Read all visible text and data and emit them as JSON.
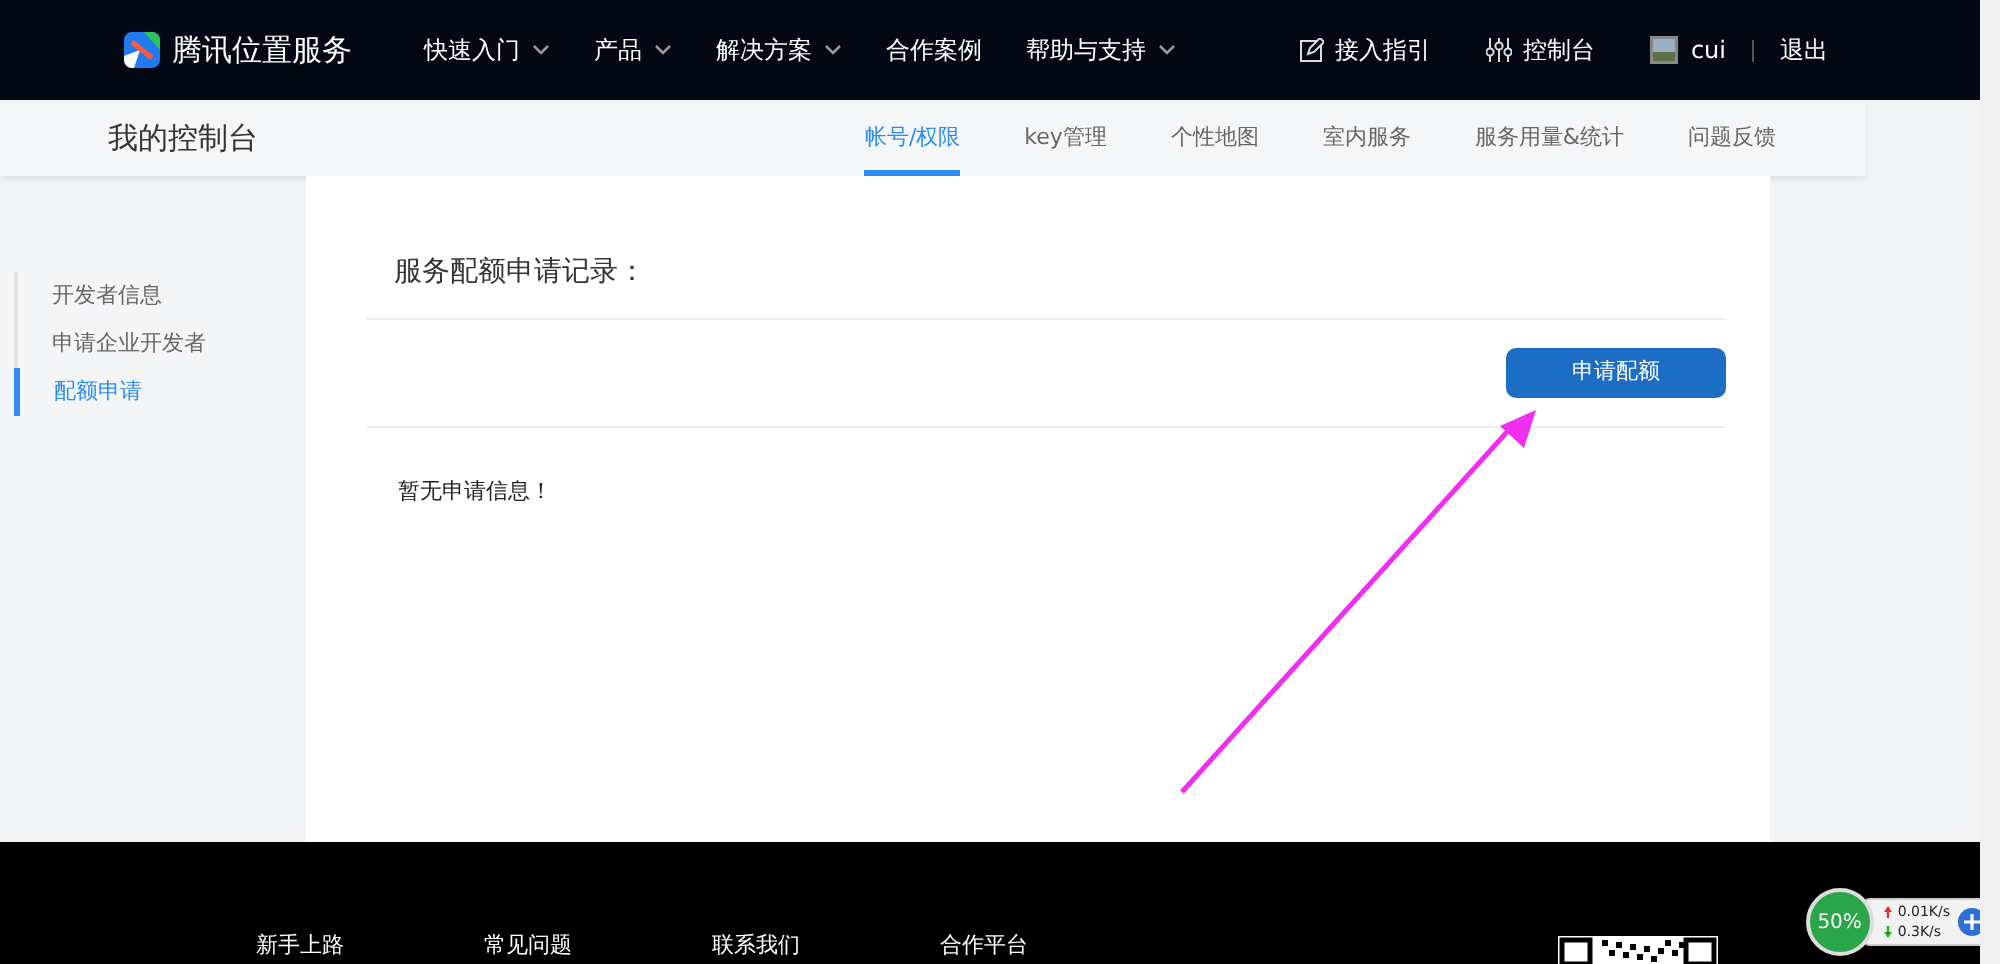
{
  "brand": "腾讯位置服务",
  "nav": [
    {
      "label": "快速入门",
      "dropdown": true
    },
    {
      "label": "产品",
      "dropdown": true
    },
    {
      "label": "解决方案",
      "dropdown": true
    },
    {
      "label": "合作案例",
      "dropdown": false
    },
    {
      "label": "帮助与支持",
      "dropdown": true
    }
  ],
  "top_links": [
    {
      "kind": "edit",
      "label": "接入指引"
    },
    {
      "kind": "sliders",
      "label": "控制台"
    }
  ],
  "user": {
    "name": "cui",
    "logout": "退出"
  },
  "console_title": "我的控制台",
  "tabs": [
    {
      "label": "帐号/权限",
      "selected": true
    },
    {
      "label": "key管理",
      "selected": false
    },
    {
      "label": "个性地图",
      "selected": false
    },
    {
      "label": "室内服务",
      "selected": false
    },
    {
      "label": "服务用量&统计",
      "selected": false
    },
    {
      "label": "问题反馈",
      "selected": false
    }
  ],
  "sidebar": {
    "items": [
      {
        "label": "开发者信息",
        "selected": false
      },
      {
        "label": "申请企业开发者",
        "selected": false
      },
      {
        "label": "配额申请",
        "selected": true
      }
    ]
  },
  "section_title": "服务配额申请记录：",
  "apply_button": "申请配额",
  "empty_message": "暂无申请信息！",
  "footer_links": [
    "新手上路",
    "常见问题",
    "联系我们",
    "合作平台"
  ],
  "net_widget": {
    "percent": "50%",
    "up": "0.01K/s",
    "down": "0.3K/s"
  }
}
